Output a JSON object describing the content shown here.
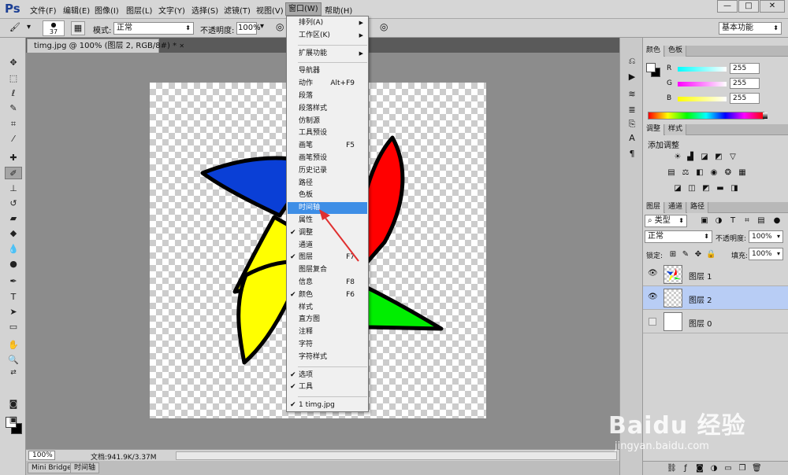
{
  "app": {
    "logo": "Ps"
  },
  "menubar": {
    "items": [
      "文件(F)",
      "编辑(E)",
      "图像(I)",
      "图层(L)",
      "文字(Y)",
      "选择(S)",
      "滤镜(T)",
      "视图(V)",
      "窗口(W)",
      "帮助(H)"
    ],
    "active": "窗口(W)"
  },
  "window_controls": {
    "minimize": "—",
    "restore": "□",
    "close": "✕"
  },
  "options": {
    "brush_size": "37",
    "mode_label": "模式:",
    "mode_value": "正常",
    "opacity_label": "不透明度:",
    "opacity_value": "100%",
    "workspace": "基本功能"
  },
  "document": {
    "tab_title": "timg.jpg @ 100% (图层 2, RGB/8#) *",
    "close": "✕",
    "zoom": "100%",
    "info": "文档:941.9K/3.37M"
  },
  "bottom_tabs": [
    "Mini Bridge",
    "时间轴"
  ],
  "window_menu": {
    "items": [
      {
        "label": "排列(A)",
        "submenu": true
      },
      {
        "label": "工作区(K)",
        "submenu": true
      },
      {
        "sep": true
      },
      {
        "label": "扩展功能",
        "submenu": true
      },
      {
        "sep": true
      },
      {
        "label": "导航器"
      },
      {
        "label": "动作",
        "shortcut": "Alt+F9"
      },
      {
        "label": "段落"
      },
      {
        "label": "段落样式"
      },
      {
        "label": "仿制源"
      },
      {
        "label": "工具预设"
      },
      {
        "label": "画笔",
        "shortcut": "F5"
      },
      {
        "label": "画笔预设"
      },
      {
        "label": "历史记录"
      },
      {
        "label": "路径"
      },
      {
        "label": "色板"
      },
      {
        "label": "时间轴",
        "highlighted": true
      },
      {
        "label": "属性"
      },
      {
        "label": "调整",
        "checked": true
      },
      {
        "label": "通道"
      },
      {
        "label": "图层",
        "checked": true,
        "shortcut": "F7"
      },
      {
        "label": "图层复合"
      },
      {
        "label": "信息",
        "shortcut": "F8"
      },
      {
        "label": "颜色",
        "checked": true,
        "shortcut": "F6"
      },
      {
        "label": "样式"
      },
      {
        "label": "直方图"
      },
      {
        "label": "注释"
      },
      {
        "label": "字符"
      },
      {
        "label": "字符样式"
      },
      {
        "sep": true
      },
      {
        "label": "选项",
        "checked": true
      },
      {
        "label": "工具",
        "checked": true
      },
      {
        "sep": true
      },
      {
        "label": "1 timg.jpg",
        "checked": true
      }
    ]
  },
  "color_panel": {
    "tabs": [
      "颜色",
      "色板"
    ],
    "rows": [
      {
        "label": "R",
        "value": "255",
        "color": "#00e5ff"
      },
      {
        "label": "G",
        "value": "255",
        "color": "#ff00ff"
      },
      {
        "label": "B",
        "value": "255",
        "color": "#ffff00"
      }
    ]
  },
  "adjust_panel": {
    "tabs": [
      "调整",
      "样式"
    ],
    "title": "添加调整"
  },
  "layers_panel": {
    "tabs": [
      "图层",
      "通道",
      "路径"
    ],
    "filter": "类型",
    "blend_mode": "正常",
    "opacity_label": "不透明度:",
    "opacity_value": "100%",
    "lock_label": "锁定:",
    "fill_label": "填充:",
    "fill_value": "100%",
    "layers": [
      {
        "name": "图层 1",
        "visible": true,
        "selected": false
      },
      {
        "name": "图层 2",
        "visible": true,
        "selected": true
      },
      {
        "name": "图层 0",
        "visible": false,
        "selected": false
      }
    ]
  },
  "watermark": {
    "brand": "Baidu 经验",
    "url": "jingyan.baidu.com"
  },
  "colors": {
    "highlight": "#3e8ee6",
    "selected_layer": "#b8cdf5",
    "blue": "#0a3fd6",
    "red": "#ff0000",
    "yellow": "#ffff00",
    "green": "#00ee00"
  }
}
